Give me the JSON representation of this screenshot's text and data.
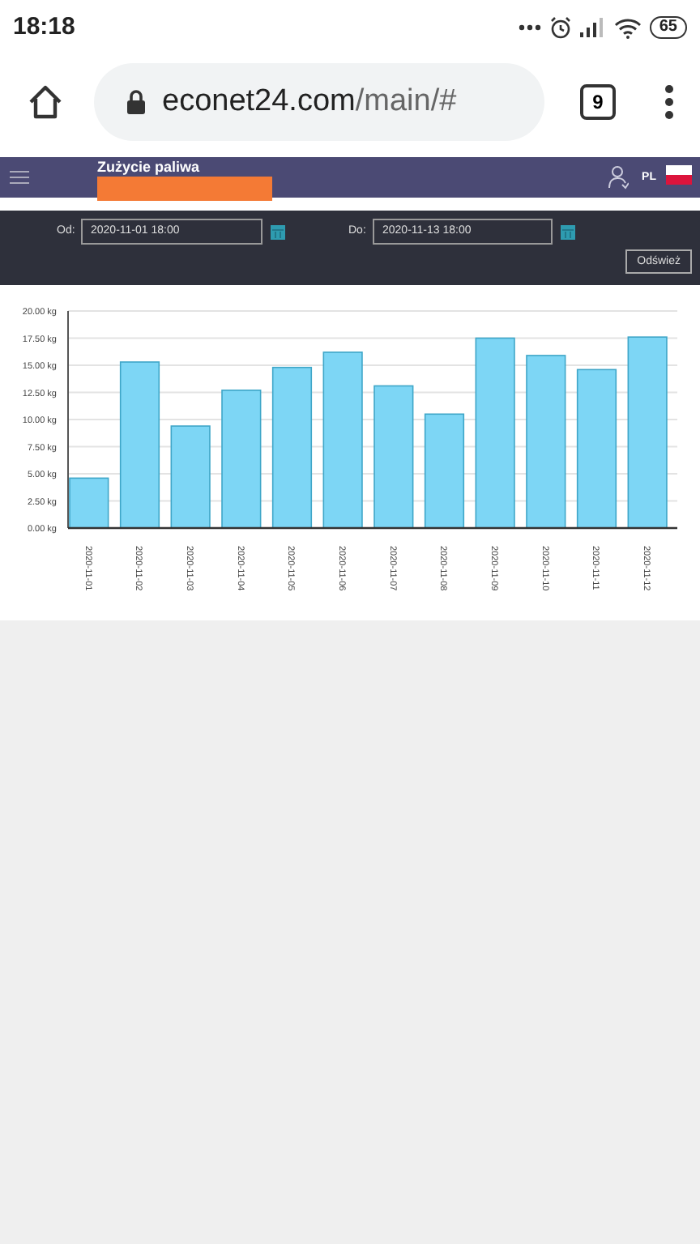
{
  "status_bar": {
    "time": "18:18",
    "battery": "65"
  },
  "browser": {
    "domain": "econet24.com",
    "path": "/main/#",
    "tab_count": "9"
  },
  "header": {
    "title": "Zużycie paliwa",
    "language": "PL"
  },
  "filters": {
    "from_label": "Od:",
    "from_value": "2020-11-01 18:00",
    "to_label": "Do:",
    "to_value": "2020-11-13 18:00",
    "refresh_button": "Odśwież"
  },
  "chart_data": {
    "type": "bar",
    "categories": [
      "2020-11-01",
      "2020-11-02",
      "2020-11-03",
      "2020-11-04",
      "2020-11-05",
      "2020-11-06",
      "2020-11-07",
      "2020-11-08",
      "2020-11-09",
      "2020-11-10",
      "2020-11-11",
      "2020-11-12"
    ],
    "series": [
      {
        "color": "#7dd6f5",
        "values": [
          4.6,
          15.3,
          9.4,
          12.7,
          14.8,
          16.2,
          13.1,
          10.5,
          17.5,
          15.9,
          14.6,
          17.6
        ]
      }
    ],
    "grid": true,
    "ylim": [
      0,
      20
    ],
    "yticks": [
      {
        "value": 0,
        "label": "0.00 kg"
      },
      {
        "value": 2.5,
        "label": "2.50 kg"
      },
      {
        "value": 5,
        "label": "5.00 kg"
      },
      {
        "value": 7.5,
        "label": "7.50 kg"
      },
      {
        "value": 10,
        "label": "10.00 kg"
      },
      {
        "value": 12.5,
        "label": "12.50 kg"
      },
      {
        "value": 15,
        "label": "15.00 kg"
      },
      {
        "value": 17.5,
        "label": "17.50 kg"
      },
      {
        "value": 20,
        "label": "20.00 kg"
      }
    ]
  }
}
